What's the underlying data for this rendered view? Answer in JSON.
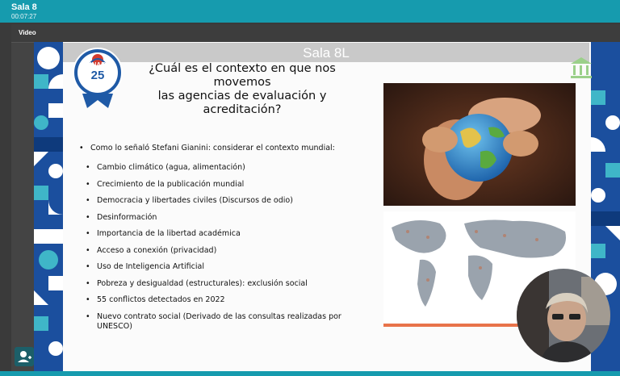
{
  "window": {
    "title": "Sala 8",
    "timer": "00:07:27"
  },
  "panel": {
    "header": "Video"
  },
  "overlay": {
    "room_label": "Sala 8L"
  },
  "slide": {
    "logo": {
      "brand": "SINAES",
      "years": "25"
    },
    "title_lines": [
      "¿Cuál es el contexto en que nos",
      "movemos",
      "las agencias de evaluación y",
      "acreditación?"
    ],
    "main_bullet": "Como lo señaló Stefani Gianini: considerar el contexto mundial:",
    "sub_bullets": [
      "Cambio climático (agua, alimentación)",
      "Crecimiento de la publicación mundial",
      "Democracia y libertades civiles (Discursos de odio)",
      "Desinformación",
      "Importancia de la libertad académica",
      "Acceso a conexión (privacidad)",
      "Uso de Inteligencia Artificial",
      "Pobreza y desigualdad (estructurales): exclusión social",
      "55 conflictos detectados en 2022",
      "Nuevo contrato social (Derivado de las consultas realizadas por",
      "UNESCO)"
    ]
  },
  "colors": {
    "accent": "#169bae",
    "slide_frame": "#1a4e9c",
    "panel": "#3a3a3a"
  }
}
